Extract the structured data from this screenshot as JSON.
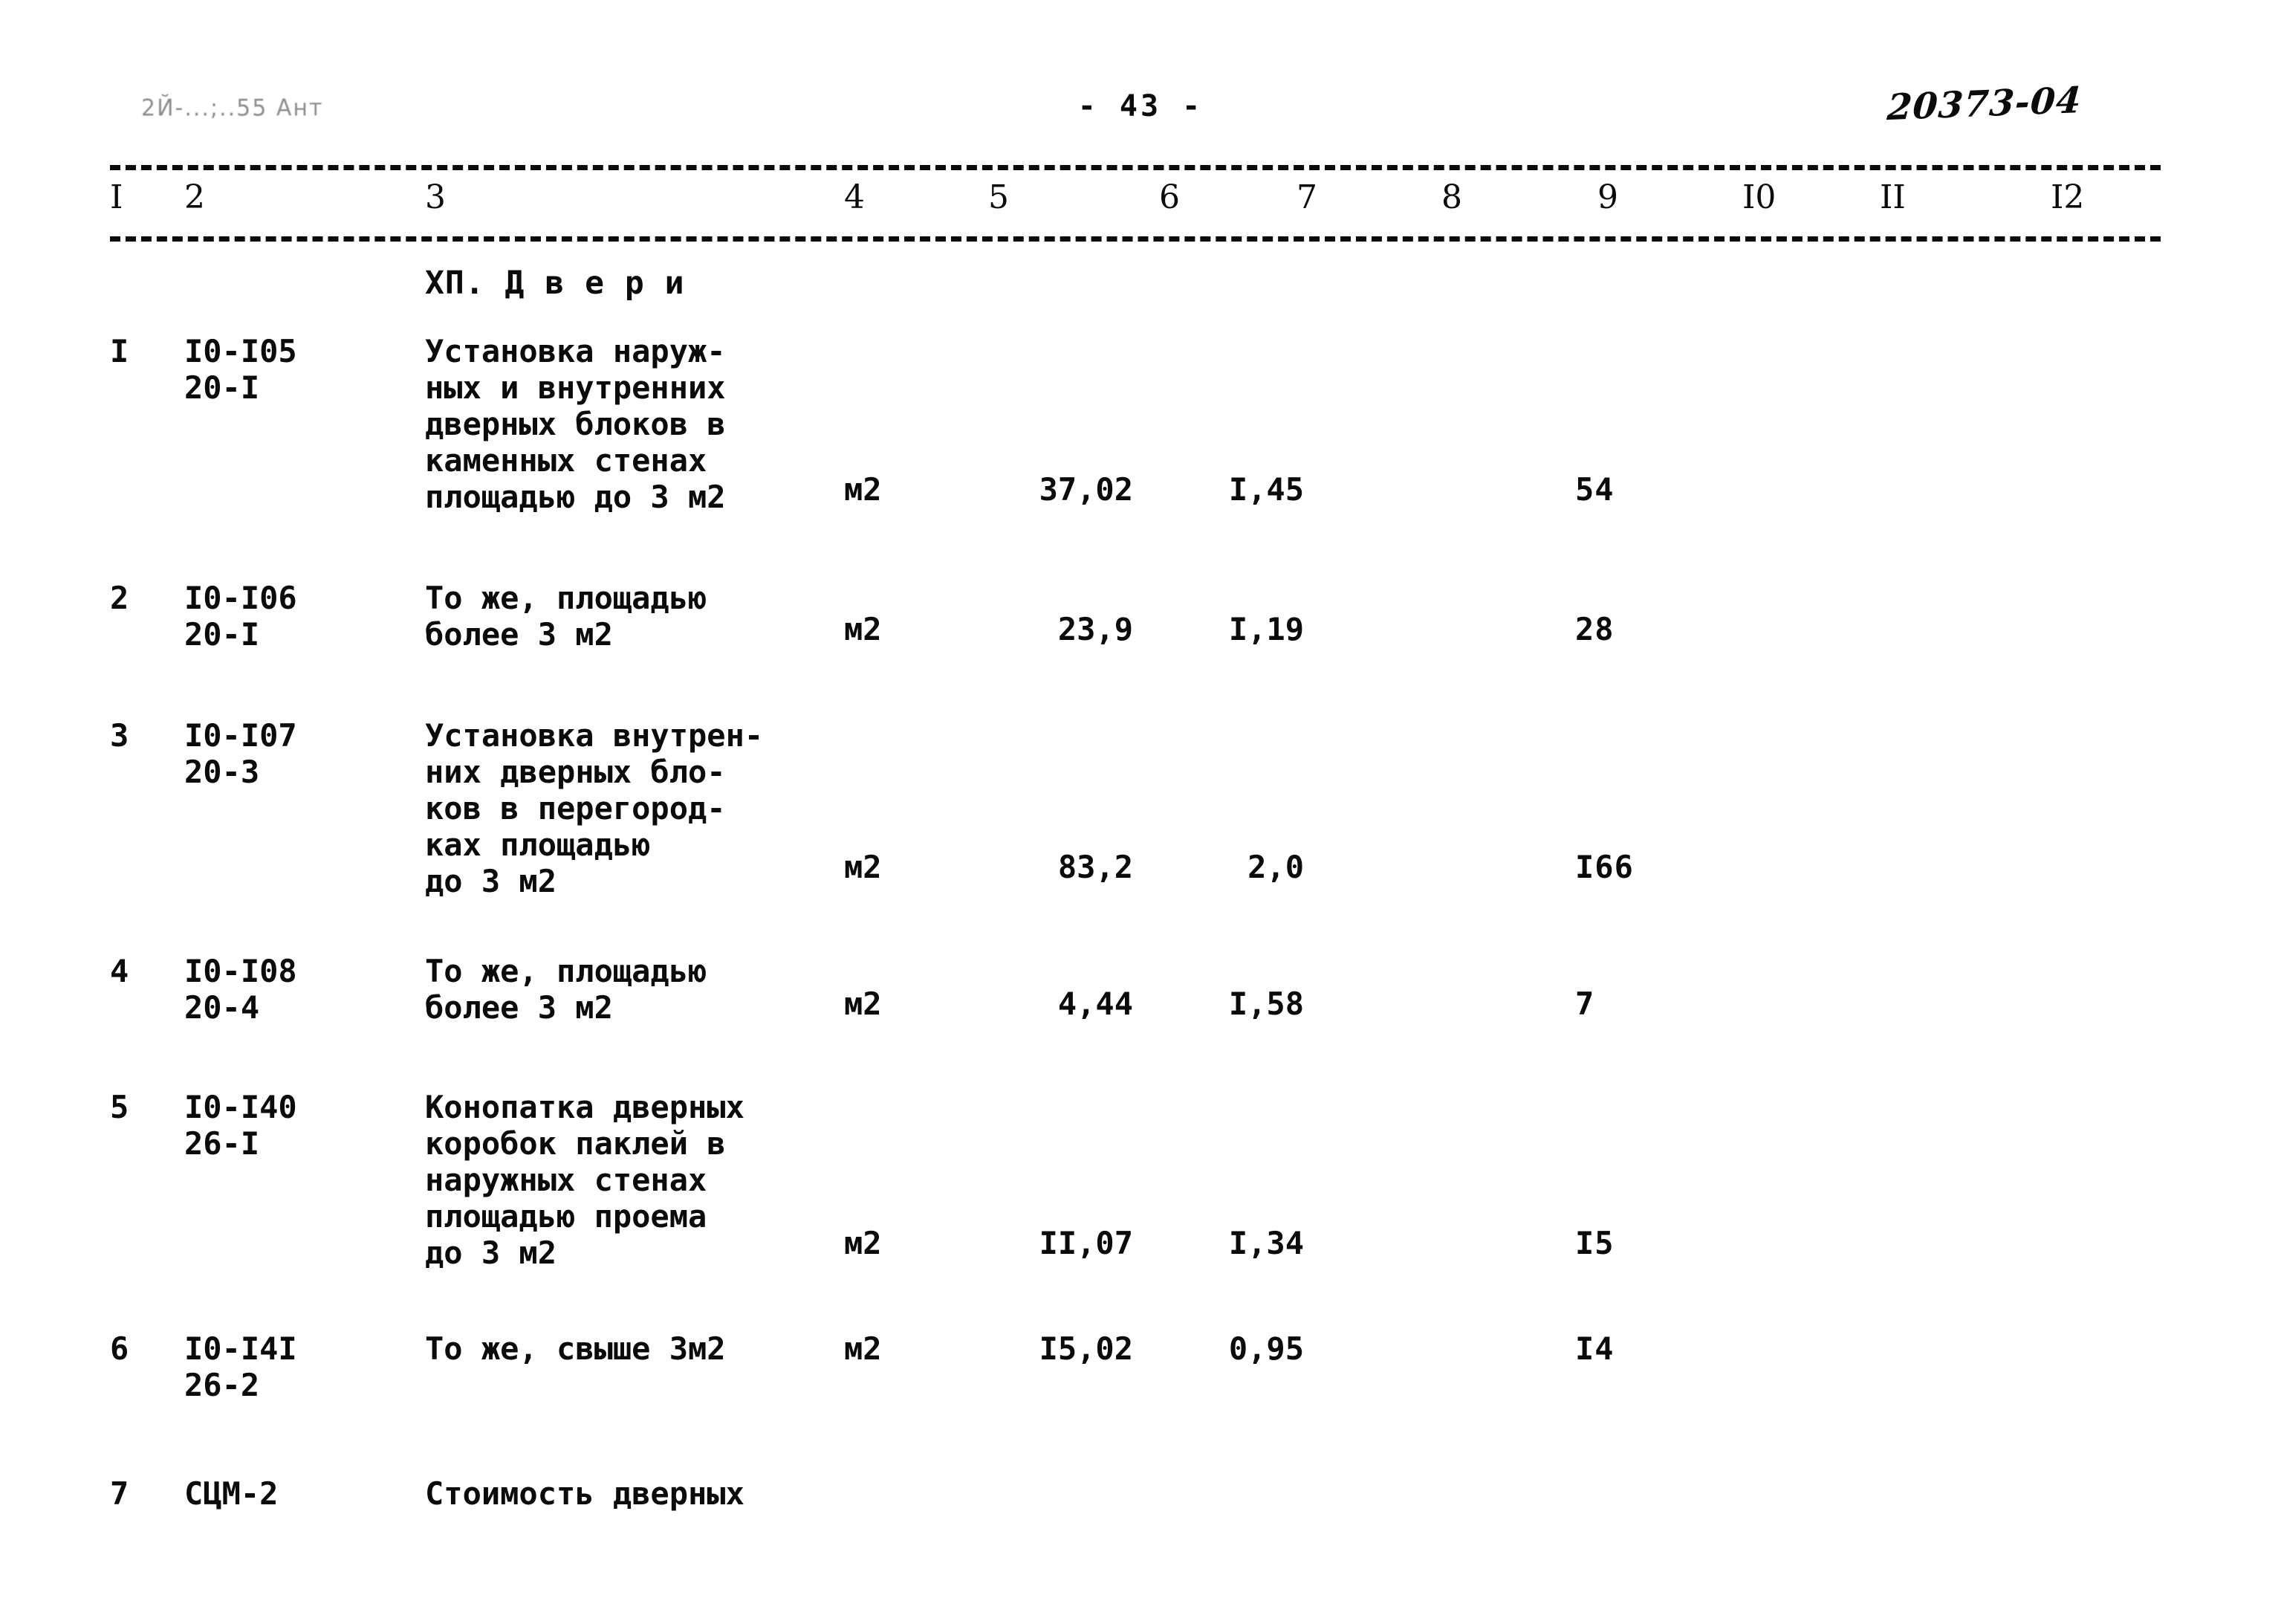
{
  "header": {
    "left_stamp": "2Й-...;..55  Ант",
    "page_number": "- 43 -",
    "handwritten_code": "20373-04"
  },
  "table": {
    "column_numbers": [
      "I",
      "2",
      "3",
      "4",
      "5",
      "6",
      "7",
      "8",
      "9",
      "I0",
      "II",
      "I2"
    ],
    "section_title": "ХП.  Д в е р и",
    "rows": [
      {
        "no": "I",
        "code": "I0-I05\n20-I",
        "description": "Установка наруж-\nных и внутренних\nдверных блоков в\nкаменных стенах\nплощадью до 3 м2",
        "unit": "м2",
        "quantity": "37,02",
        "norm": "I,45",
        "total": "54"
      },
      {
        "no": "2",
        "code": "I0-I06\n20-I",
        "description": "То же, площадью\nболее 3 м2",
        "unit": "м2",
        "quantity": "23,9",
        "norm": "I,19",
        "total": "28"
      },
      {
        "no": "3",
        "code": "I0-I07\n20-3",
        "description": "Установка внутрен-\nних дверных бло-\nков в перегород-\nках площадью\nдо 3 м2",
        "unit": "м2",
        "quantity": "83,2",
        "norm": "2,0",
        "total": "I66"
      },
      {
        "no": "4",
        "code": "I0-I08\n20-4",
        "description": "То же, площадью\nболее 3 м2",
        "unit": "м2",
        "quantity": "4,44",
        "norm": "I,58",
        "total": "7"
      },
      {
        "no": "5",
        "code": "I0-I40\n26-I",
        "description": "Конопатка дверных\nкоробок паклей в\nнаружных стенах\nплощадью проема\nдо 3 м2",
        "unit": "м2",
        "quantity": "II,07",
        "norm": "I,34",
        "total": "I5"
      },
      {
        "no": "6",
        "code": "I0-I4I\n26-2",
        "description": "То же, свыше 3м2",
        "unit": "м2",
        "quantity": "I5,02",
        "norm": "0,95",
        "total": "I4"
      },
      {
        "no": "7",
        "code": "СЦМ-2",
        "description": "Стоимость дверных",
        "unit": "",
        "quantity": "",
        "norm": "",
        "total": ""
      }
    ]
  },
  "layout": {
    "colnum_x": [
      148,
      248,
      572,
      1136,
      1330,
      1560,
      1745,
      1940,
      2150,
      2345,
      2530,
      2760
    ],
    "row_top": [
      448,
      780,
      965,
      1282,
      1465,
      1790,
      1985
    ],
    "row_value_top": [
      634,
      822,
      1142,
      1326,
      1648,
      1790,
      null
    ]
  }
}
